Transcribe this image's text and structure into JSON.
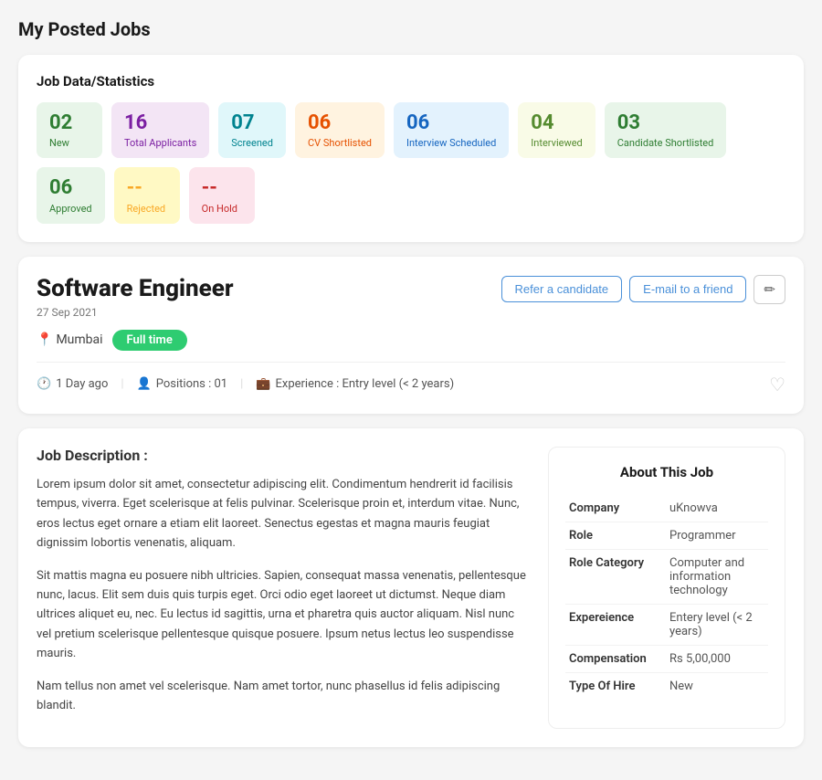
{
  "page": {
    "title": "My Posted Jobs"
  },
  "stats": {
    "section_title": "Job Data/Statistics",
    "items": [
      {
        "number": "02",
        "label": "New",
        "bg": "#e8f5e9",
        "color": "#2e7d32"
      },
      {
        "number": "16",
        "label": "Total Applicants",
        "bg": "#f3e5f5",
        "color": "#7b1fa2"
      },
      {
        "number": "07",
        "label": "Screened",
        "bg": "#e0f7fa",
        "color": "#00838f"
      },
      {
        "number": "06",
        "label": "CV Shortlisted",
        "bg": "#fff3e0",
        "color": "#e65100"
      },
      {
        "number": "06",
        "label": "Interview Scheduled",
        "bg": "#e3f2fd",
        "color": "#1565c0"
      },
      {
        "number": "04",
        "label": "Interviewed",
        "bg": "#f9fbe7",
        "color": "#558b2f"
      },
      {
        "number": "03",
        "label": "Candidate Shortlisted",
        "bg": "#e8f5e9",
        "color": "#2e7d32"
      },
      {
        "number": "06",
        "label": "Approved",
        "bg": "#e8f5e9",
        "color": "#2e7d32"
      },
      {
        "number": "--",
        "label": "Rejected",
        "bg": "#fff9c4",
        "color": "#f9a825"
      },
      {
        "number": "--",
        "label": "On Hold",
        "bg": "#fce4ec",
        "color": "#c62828"
      }
    ]
  },
  "job": {
    "title": "Software Engineer",
    "date": "27 Sep 2021",
    "location": "Mumbai",
    "job_type": "Full time",
    "time_ago": "1 Day ago",
    "positions": "Positions : 01",
    "experience": "Experience : Entry level (< 2 years)",
    "refer_label": "Refer a candidate",
    "email_label": "E-mail to a friend",
    "edit_icon": "✏"
  },
  "description": {
    "section_title": "Job Description :",
    "paragraphs": [
      "Lorem ipsum dolor sit amet, consectetur adipiscing elit. Condimentum hendrerit id facilisis tempus, viverra. Eget scelerisque at felis pulvinar. Scelerisque proin et, interdum vitae. Nunc, eros lectus eget ornare a etiam elit laoreet. Senectus egestas et magna mauris feugiat dignissim lobortis venenatis, aliquam.",
      "Sit mattis magna eu posuere nibh ultricies. Sapien, consequat massa venenatis, pellentesque nunc, lacus. Elit sem duis quis turpis eget. Orci odio eget laoreet ut dictumst. Neque diam ultrices aliquet eu, nec. Eu lectus id sagittis, urna et pharetra quis auctor aliquam. Nisl nunc vel pretium scelerisque pellentesque quisque posuere. Ipsum netus lectus leo suspendisse mauris.",
      "Nam tellus non amet vel scelerisque. Nam amet tortor, nunc phasellus id felis adipiscing blandit."
    ]
  },
  "about": {
    "title": "About This Job",
    "rows": [
      {
        "key": "Company",
        "value": "uKnowva"
      },
      {
        "key": "Role",
        "value": "Programmer"
      },
      {
        "key": "Role Category",
        "value": "Computer and information technology"
      },
      {
        "key": "Expereience",
        "value": "Entery level (< 2 years)"
      },
      {
        "key": "Compensation",
        "value": "Rs 5,00,000"
      },
      {
        "key": "Type Of Hire",
        "value": "New"
      }
    ]
  }
}
